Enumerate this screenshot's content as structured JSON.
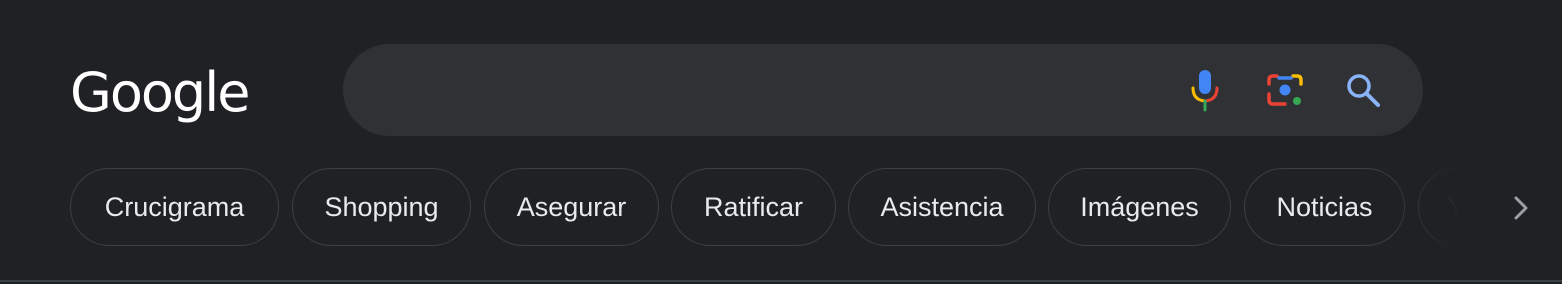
{
  "logo": {
    "text": "Google"
  },
  "search": {
    "value": "",
    "placeholder": "",
    "voice_icon": "microphone-icon",
    "lens_icon": "google-lens-icon",
    "search_icon": "magnifier-icon"
  },
  "chips": [
    {
      "label": "Crucigrama"
    },
    {
      "label": "Shopping"
    },
    {
      "label": "Asegurar"
    },
    {
      "label": "Ratificar"
    },
    {
      "label": "Asistencia"
    },
    {
      "label": "Imágenes"
    },
    {
      "label": "Noticias"
    },
    {
      "label": "Y a"
    }
  ],
  "next_icon": "chevron-right-icon",
  "colors": {
    "background": "#202124",
    "search_box": "#303134",
    "chip_border": "#3c4043",
    "text": "#e8eaed",
    "google_blue": "#4285f4",
    "google_red": "#ea4335",
    "google_yellow": "#fbbc04",
    "google_green": "#34a853",
    "search_icon_blue": "#8ab4f8"
  }
}
